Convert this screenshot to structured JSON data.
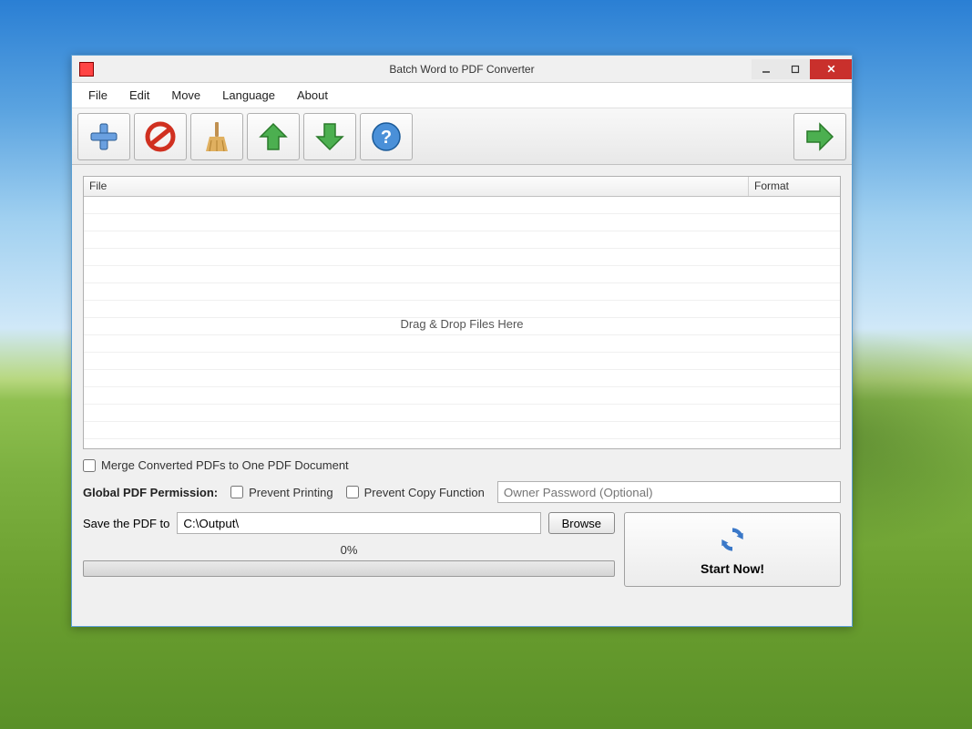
{
  "window": {
    "title": "Batch Word to PDF Converter"
  },
  "menu": {
    "file": "File",
    "edit": "Edit",
    "move": "Move",
    "language": "Language",
    "about": "About"
  },
  "table": {
    "col_file": "File",
    "col_format": "Format",
    "drop_hint": "Drag & Drop Files Here"
  },
  "options": {
    "merge_label": "Merge Converted PDFs to One PDF Document",
    "permission_label": "Global PDF Permission:",
    "prevent_print": "Prevent Printing",
    "prevent_copy": "Prevent Copy Function",
    "owner_pw_placeholder": "Owner Password (Optional)"
  },
  "save": {
    "label": "Save the PDF to",
    "path": "C:\\Output\\",
    "browse": "Browse"
  },
  "progress": {
    "text": "0%"
  },
  "start": {
    "label": "Start Now!"
  }
}
